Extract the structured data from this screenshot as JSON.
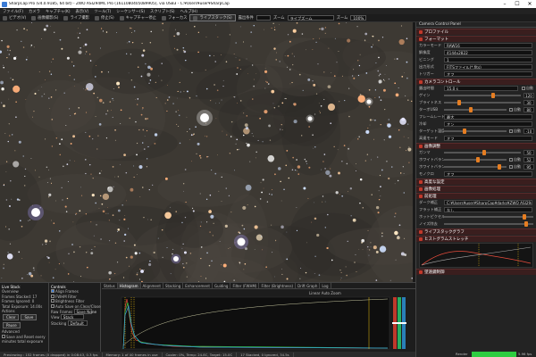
{
  "window": {
    "title": "SharpCap Pro (v4.0.9185, 64 bit) - ZWO ASI294MC Pro (1611080405089905), via USB3 - C:¥Users¥user¥SharpCap"
  },
  "menu": [
    "ファイル(F)",
    "カメラ",
    "キャプチャ(K)",
    "表示(V)",
    "ツール(T)",
    "シーケンサー(S)",
    "スクリプト(S)",
    "ヘルプ(H)"
  ],
  "toolbar": {
    "items": [
      "ビデオ(V)",
      "画像撮影(S)",
      "ライブ撮影",
      "停止(S)",
      "キャプチャー停止",
      "フォーカス",
      "ライブスタック(S)"
    ],
    "exp_label": "露出条件",
    "exp_value": "",
    "mode_label": "ズーム",
    "mode_value": "ライブズーム",
    "zoom_label": "ズーム",
    "zoom_value": "100%"
  },
  "panel": {
    "title": "Camera Control Panel",
    "sections": {
      "profile": "プロファイル",
      "format": "フォーマット",
      "control": "カメラコントロール",
      "display": "画像調整",
      "advanced": "高度な設定",
      "processing": "画像処理",
      "preprocess": "前処理",
      "stack": "ライブスタックグラフ",
      "histo": "ヒストグラムストレッチ",
      "annotate": "望遠鏡制御"
    },
    "format_rows": [
      {
        "label": "カラーモード",
        "value": "RAW16"
      },
      {
        "label": "解像度",
        "value": "4144x2822"
      },
      {
        "label": "ビニング",
        "value": "1"
      },
      {
        "label": "出力形式",
        "value": "FITSファイル(*.fits)"
      },
      {
        "label": "トリガー",
        "value": "オフ"
      }
    ],
    "control_rows": [
      {
        "label": "露出時間",
        "value": "15.0 s"
      },
      {
        "label": "ゲイン",
        "value": "120"
      },
      {
        "label": "ブライトネス",
        "value": "30"
      },
      {
        "label": "ターボUSB",
        "value": "80"
      },
      {
        "label": "フレームレート",
        "value": "最大"
      },
      {
        "label": "冷却",
        "value": "オン"
      },
      {
        "label": "ターゲット温度",
        "value": "-10"
      },
      {
        "label": "高速モード",
        "value": "オフ"
      }
    ],
    "control_nums": [
      "120",
      "30",
      "80",
      "-10"
    ],
    "display_rows": [
      {
        "label": "ガンマ",
        "value": "50"
      },
      {
        "label": "ホワイトバランス(赤)",
        "value": "52"
      },
      {
        "label": "ホワイトバランス(青)",
        "value": "95"
      },
      {
        "label": "モノクロ",
        "value": "オフ"
      }
    ],
    "display_nums": [
      "50",
      "52",
      "95"
    ],
    "processing_rows": [
      {
        "label": "ダーク補正",
        "value": "C:¥Users¥user¥SharpCap¥darks¥ZWO ASI294MC"
      },
      {
        "label": "フラット補正",
        "value": "なし"
      },
      {
        "label": "ホットピクセル",
        "value": "オフ"
      },
      {
        "label": "ノイズ除去",
        "value": "0"
      }
    ],
    "auto_label": "自動"
  },
  "livestack": {
    "title": "Live Stack",
    "overview_label": "Overview",
    "frames_stacked": "Frames Stacked: 17",
    "frames_ignored": "Frames Ignored: 0",
    "total_exposure": "Total Exposure: 14.00s",
    "actions_label": "Actions",
    "clear": "Clear",
    "save": "Save",
    "pause": "Pause",
    "advanced_label": "Advanced",
    "save_reset": "Save and Reset every",
    "minutes": "minutes total exposure"
  },
  "controls": {
    "title": "Controls",
    "align": "Align Frames",
    "fwhm": "FWHM Filter",
    "bright": "Brightness Filter",
    "autosave": "Auto Save on Clear/Close",
    "raw_frames_label": "Raw Frames",
    "raw_frames_value": "Save None",
    "view_label": "View",
    "view_value": "Stack",
    "stacking_label": "Stacking",
    "stacking_value": "Default"
  },
  "tabs": [
    "Status",
    "Histogram",
    "Alignment",
    "Stacking",
    "Enhancement",
    "Guiding",
    "Filter (FWHM)",
    "Filter (Brightness)",
    "Drift Graph",
    "Log"
  ],
  "histogram": {
    "mode_linear": "Linear",
    "mode_auto": "Auto",
    "mode_zoom": "Zoom"
  },
  "status": {
    "processing": "Previewing : 152 frames (0 dropped) in 0:08:43, 0.3 fps",
    "memory": "Memory: 1 of 40 frames in use",
    "cooler": "Cooler: 0%, Temp: 24.8C, Target: 15.0C",
    "stacked": "17 Stacked, 0 Ignored, 34.5s",
    "render_label": "Render",
    "fps": "5.96 fps"
  }
}
